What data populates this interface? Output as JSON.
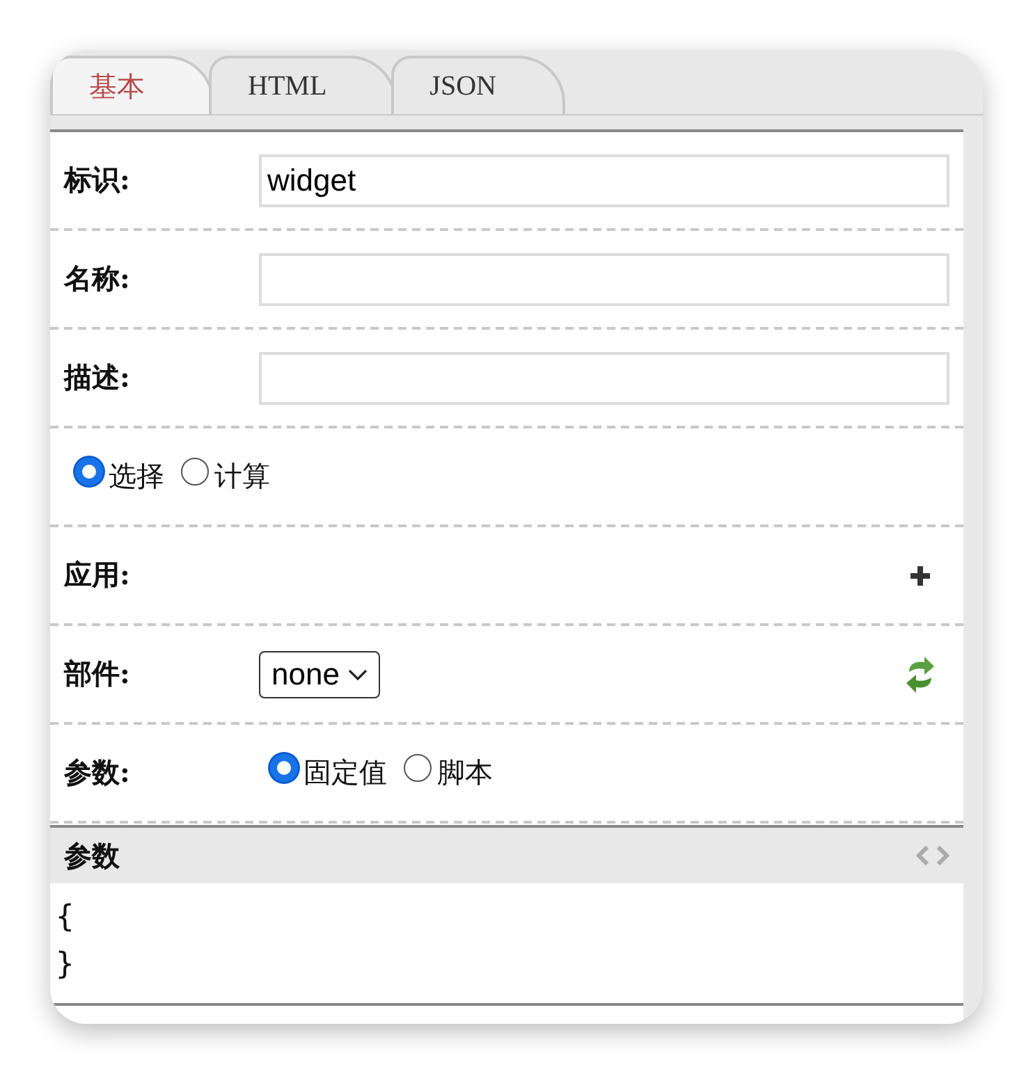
{
  "tabs": [
    {
      "label": "基本",
      "selected": true
    },
    {
      "label": "HTML",
      "selected": false
    },
    {
      "label": "JSON",
      "selected": false
    }
  ],
  "rows": [
    {
      "kind": "text",
      "label": "标识:",
      "value": "widget"
    },
    {
      "kind": "text",
      "label": "名称:",
      "value": ""
    },
    {
      "kind": "text",
      "label": "描述:",
      "value": ""
    },
    {
      "kind": "radio",
      "options": [
        {
          "label": "选择",
          "selected": true
        },
        {
          "label": "计算",
          "selected": false
        }
      ]
    },
    {
      "kind": "add",
      "label": "应用:"
    },
    {
      "kind": "select",
      "label": "部件:",
      "value": "none"
    },
    {
      "kind": "radio",
      "label": "参数:",
      "options": [
        {
          "label": "固定值",
          "selected": true
        },
        {
          "label": "脚本",
          "selected": false
        }
      ]
    }
  ],
  "editor": {
    "title": "参数",
    "lines": [
      "{",
      "}"
    ]
  }
}
